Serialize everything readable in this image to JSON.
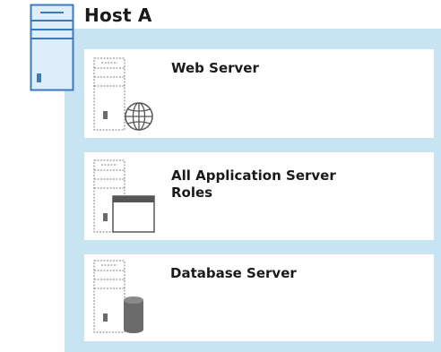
{
  "host": {
    "title": "Host A"
  },
  "roles": [
    {
      "label": "Web Server",
      "icon": "server-globe-icon"
    },
    {
      "label": "All Application Server Roles",
      "icon": "server-window-icon"
    },
    {
      "label": "Database Server",
      "icon": "server-database-icon"
    }
  ],
  "colors": {
    "host_fill": "#c8e3f2",
    "host_icon_stroke": "#3a7bbd",
    "host_icon_fill": "#ddeefa",
    "server_outline": "#7f7f7f",
    "database_fill": "#6b6b6b"
  }
}
